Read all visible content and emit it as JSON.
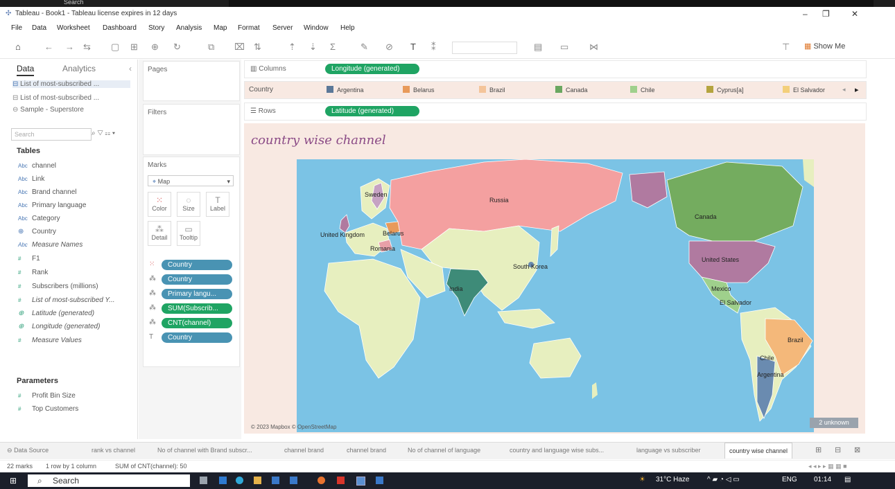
{
  "window": {
    "title": "Tableau - Book1 - Tableau license expires in 12 days",
    "top_search": "Search"
  },
  "menu": [
    "File",
    "Data",
    "Worksheet",
    "Dashboard",
    "Story",
    "Analysis",
    "Map",
    "Format",
    "Server",
    "Window",
    "Help"
  ],
  "toolbar": {
    "show_me": "Show Me"
  },
  "data_pane": {
    "tab_data": "Data",
    "tab_analytics": "Analytics",
    "sources": [
      "List of most-subscribed ...",
      "List of most-subscribed ...",
      "Sample - Superstore"
    ],
    "search_placeholder": "Search",
    "tables_title": "Tables",
    "fields": [
      {
        "type": "Abc",
        "name": "channel"
      },
      {
        "type": "Abc",
        "name": "Link"
      },
      {
        "type": "Abc",
        "name": "Brand channel"
      },
      {
        "type": "Abc",
        "name": "Primary language"
      },
      {
        "type": "Abc",
        "name": "Category"
      },
      {
        "type": "geo",
        "name": "Country"
      },
      {
        "type": "Abc",
        "name": "Measure Names"
      },
      {
        "type": "#",
        "name": "F1"
      },
      {
        "type": "#",
        "name": "Rank"
      },
      {
        "type": "#",
        "name": "Subscribers (millions)"
      },
      {
        "type": "#",
        "name": "List of most-subscribed Y..."
      },
      {
        "type": "geo",
        "name": "Latitude (generated)"
      },
      {
        "type": "geo",
        "name": "Longitude (generated)"
      },
      {
        "type": "#",
        "name": "Measure Values"
      }
    ],
    "parameters_title": "Parameters",
    "parameters": [
      "Profit Bin Size",
      "Top Customers"
    ]
  },
  "cards": {
    "pages": "Pages",
    "filters": "Filters",
    "marks": "Marks",
    "mark_type": "Map",
    "mark_buttons": [
      "Color",
      "Size",
      "Label",
      "Detail",
      "Tooltip"
    ],
    "mark_pills": [
      "Country",
      "Country",
      "Primary langu...",
      "SUM(Subscrib...",
      "CNT(channel)",
      "Country"
    ]
  },
  "shelves": {
    "columns_label": "Columns",
    "columns_pill": "Longitude (generated)",
    "rows_label": "Rows",
    "rows_pill": "Latitude (generated)",
    "legend_label": "Country",
    "legend": [
      {
        "name": "Argentina",
        "color": "#5b7898"
      },
      {
        "name": "Belarus",
        "color": "#e89a5a"
      },
      {
        "name": "Brazil",
        "color": "#f4c49a"
      },
      {
        "name": "Canada",
        "color": "#6aa760"
      },
      {
        "name": "Chile",
        "color": "#9fd08c"
      },
      {
        "name": "Cyprus[a]",
        "color": "#b4a43e"
      },
      {
        "name": "El Salvador",
        "color": "#f3cf7a"
      }
    ]
  },
  "view": {
    "title": "country wise channel",
    "copyright": "© 2023 Mapbox © OpenStreetMap",
    "unknown_badge": "2 unknown",
    "labels": [
      "Sweden",
      "Russia",
      "Belarus",
      "United Kingdom",
      "Romania",
      "South Korea",
      "India",
      "Canada",
      "United States",
      "Mexico",
      "El Salvador",
      "Brazil",
      "Chile",
      "Argentina"
    ]
  },
  "sheet_tabs": {
    "data_source": "Data Source",
    "tabs": [
      "rank vs channel",
      "No of channel with Brand subscr...",
      "channel brand",
      "channel brand",
      "No of channel of language",
      "country and language wise subs...",
      "language vs subscriber"
    ],
    "active": "country wise channel"
  },
  "status": {
    "marks": "22 marks",
    "rows_cols": "1 row by 1 column",
    "sum": "SUM of CNT(channel): 50"
  },
  "taskbar": {
    "search": "Search",
    "weather": "31°C Haze",
    "lang": "ENG",
    "time": "01:14"
  },
  "colors": {
    "russia": "#f4a0a0",
    "asia": "#e7efbf",
    "india": "#3e8b78",
    "canada": "#74ac5f",
    "usa": "#b07aa0",
    "brazil": "#f4b87a",
    "argentina": "#6a8bb0",
    "ocean": "#7bc3e5",
    "accent_pill": "#4993b3",
    "green_pill": "#1fa463"
  }
}
